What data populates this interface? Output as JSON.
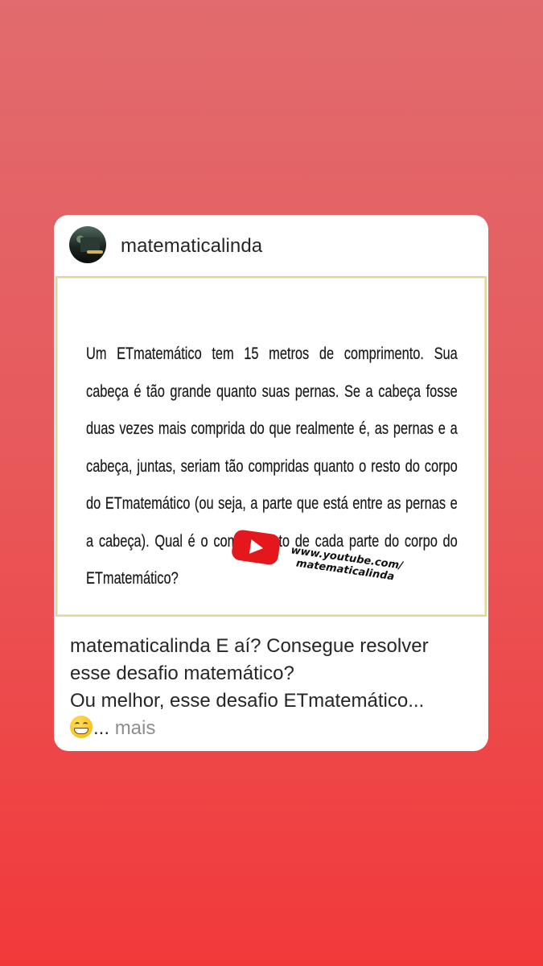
{
  "post": {
    "username": "matematicalinda",
    "image_text": "Um ETmatemático tem 15 metros de comprimento. Sua cabeça é tão grande quanto suas pernas. Se a cabeça fosse duas vezes mais comprida do que realmente é, as pernas e a cabeça, juntas, seriam tão compridas quanto o resto do corpo do ETmatemático (ou seja, a parte que está entre as pernas e a cabeça). Qual é o comprimento de cada parte do corpo do ETmatemático?",
    "youtube_url_line1": "www.youtube.com/",
    "youtube_url_line2": "matematicalinda",
    "caption_user": "matematicalinda",
    "caption_line1": "E aí? Consegue resolver esse desafio matemático?",
    "caption_line2": "Ou melhor, esse desafio ETmatemático...",
    "caption_ellipsis": "...",
    "more_label": "mais",
    "emoji": "grinning-face-with-smiling-eyes"
  },
  "colors": {
    "background_top": "#e16b6e",
    "background_bottom": "#f2393a",
    "card": "#ffffff",
    "youtube_red": "#e3171c",
    "muted_text": "#8e8e8e"
  }
}
